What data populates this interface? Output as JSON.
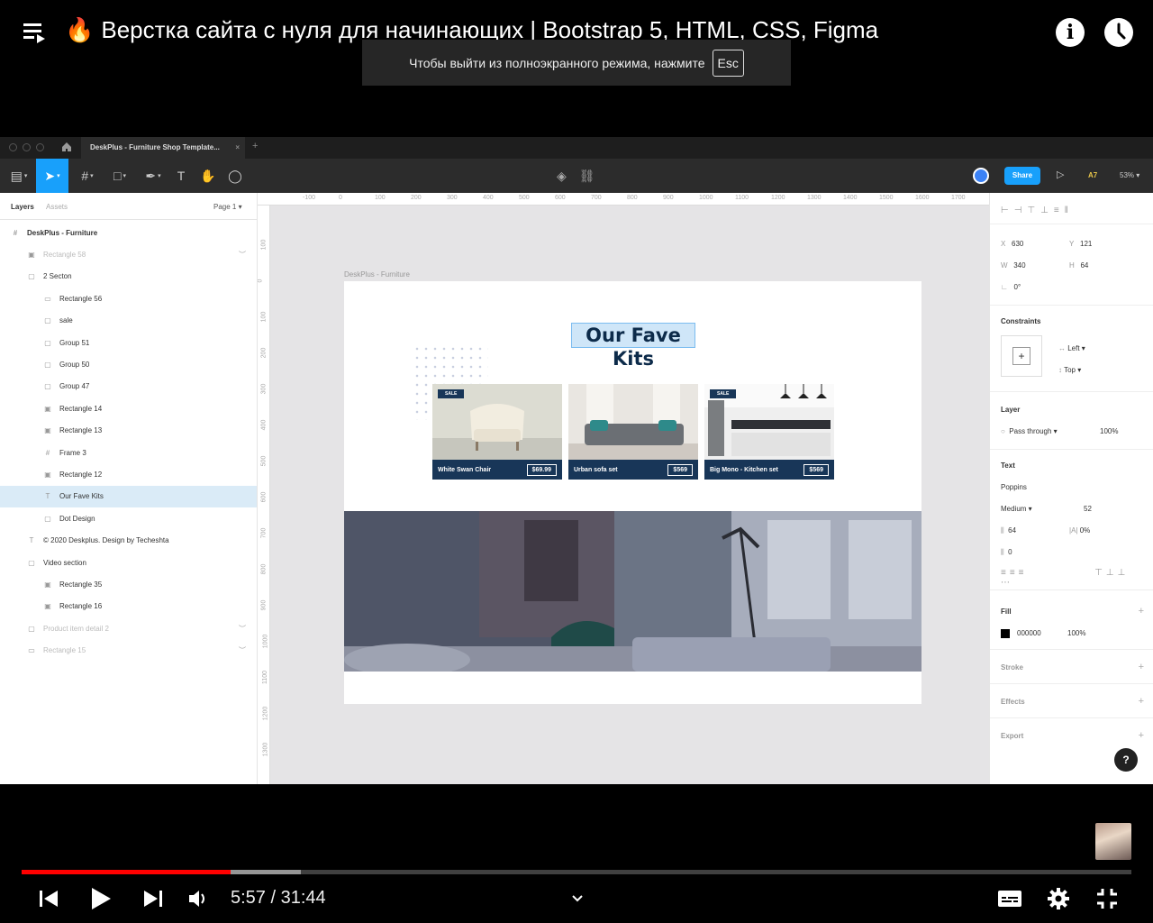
{
  "video": {
    "title": "Верстка сайта с нуля для начинающих | Bootstrap 5, HTML, CSS, Figma",
    "title_emoji": "🔥",
    "fullscreen_hint": "Чтобы выйти из полноэкранного режима, нажмите",
    "fullscreen_key": "Esc",
    "info_icon": "info-icon",
    "watch_later_icon": "clock-icon",
    "playlist_icon": "playlist-icon"
  },
  "figma": {
    "tab_title": "DeskPlus - Furniture Shop Template...",
    "tab_close": "×",
    "new_tab": "+",
    "share_label": "Share",
    "user_initials": "A7",
    "zoom": "53%",
    "layers_tab": "Layers",
    "assets_tab": "Assets",
    "page_selector": "Page 1",
    "layers": [
      {
        "label": "DeskPlus - Furniture",
        "icon": "frame-icon",
        "indent": 0,
        "style": "bold"
      },
      {
        "label": "Rectangle 58",
        "icon": "image-icon",
        "indent": 1,
        "style": "dim",
        "expand": "︶"
      },
      {
        "label": "2 Secton",
        "icon": "group-icon",
        "indent": 1,
        "style": ""
      },
      {
        "label": "Rectangle 56",
        "icon": "rect-icon",
        "indent": 2,
        "style": ""
      },
      {
        "label": "sale",
        "icon": "group-icon",
        "indent": 2,
        "style": ""
      },
      {
        "label": "Group 51",
        "icon": "group-icon",
        "indent": 2,
        "style": ""
      },
      {
        "label": "Group 50",
        "icon": "group-icon",
        "indent": 2,
        "style": ""
      },
      {
        "label": "Group 47",
        "icon": "group-icon",
        "indent": 2,
        "style": ""
      },
      {
        "label": "Rectangle 14",
        "icon": "image-icon",
        "indent": 2,
        "style": ""
      },
      {
        "label": "Rectangle 13",
        "icon": "image-icon",
        "indent": 2,
        "style": ""
      },
      {
        "label": "Frame 3",
        "icon": "frame-icon",
        "indent": 2,
        "style": ""
      },
      {
        "label": "Rectangle 12",
        "icon": "image-icon",
        "indent": 2,
        "style": ""
      },
      {
        "label": "Our Fave Kits",
        "icon": "text-icon",
        "indent": 2,
        "style": "sel"
      },
      {
        "label": "Dot Design",
        "icon": "group-icon",
        "indent": 2,
        "style": ""
      },
      {
        "label": "© 2020 Deskplus. Design by Techeshta",
        "icon": "text-icon",
        "indent": 1,
        "style": ""
      },
      {
        "label": "Video section",
        "icon": "group-icon",
        "indent": 1,
        "style": ""
      },
      {
        "label": "Rectangle 35",
        "icon": "image-icon",
        "indent": 2,
        "style": ""
      },
      {
        "label": "Rectangle 16",
        "icon": "image-icon",
        "indent": 2,
        "style": ""
      },
      {
        "label": "Product item detail 2",
        "icon": "group-icon",
        "indent": 1,
        "style": "dim",
        "expand": "︶"
      },
      {
        "label": "Rectangle 15",
        "icon": "rect-icon",
        "indent": 1,
        "style": "dim",
        "expand": "︶"
      }
    ],
    "ruler_top": [
      "-100",
      "0",
      "100",
      "200",
      "300",
      "400",
      "500",
      "600",
      "700",
      "800",
      "900",
      "1000",
      "1100",
      "1200",
      "1300",
      "1400",
      "1500",
      "1600",
      "1700"
    ],
    "ruler_left": [
      "100",
      "0",
      "100",
      "200",
      "300",
      "400",
      "500",
      "600",
      "700",
      "800",
      "900",
      "1000",
      "1100",
      "1200",
      "1300"
    ],
    "artboard_label": "DeskPlus - Furniture",
    "headline": "Our Fave Kits",
    "cards": [
      {
        "name": "White Swan Chair",
        "price": "$69.99",
        "sale": "SALE"
      },
      {
        "name": "Urban sofa set",
        "price": "$569",
        "sale": ""
      },
      {
        "name": "Big Mono - Kitchen set",
        "price": "$569",
        "sale": "SALE"
      }
    ],
    "design": {
      "x_label": "X",
      "x": "630",
      "y_label": "Y",
      "y": "121",
      "w_label": "W",
      "w": "340",
      "h_label": "H",
      "h": "64",
      "rotation_icon": "∟",
      "rotation": "0°",
      "constraints_title": "Constraints",
      "constraint_h": "Left",
      "constraint_v": "Top",
      "layer_title": "Layer",
      "blend": "Pass through",
      "opacity": "100%",
      "text_title": "Text",
      "font": "Poppins",
      "weight": "Medium",
      "size": "52",
      "line_height": "64",
      "letter_spacing": "0%",
      "paragraph_spacing": "0",
      "fill_title": "Fill",
      "fill_hex": "000000",
      "fill_opacity": "100%",
      "stroke_title": "Stroke",
      "effects_title": "Effects",
      "export_title": "Export",
      "help": "?"
    }
  },
  "player": {
    "current_time": "5:57",
    "separator": " / ",
    "duration": "31:44",
    "played_fraction": 0.1887,
    "buffered_fraction": 0.2515,
    "colors": {
      "progress": "#ff0000",
      "figma_blue": "#18a0fb",
      "card_navy": "#183658",
      "selection": "#daebf7"
    }
  }
}
